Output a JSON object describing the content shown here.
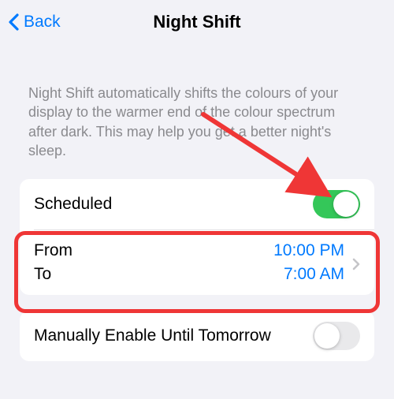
{
  "nav": {
    "back_label": "Back",
    "title": "Night Shift"
  },
  "description": "Night Shift automatically shifts the colours of your display to the warmer end of the colour spectrum after dark. This may help you get a better night's sleep.",
  "scheduled": {
    "label": "Scheduled",
    "enabled": true
  },
  "schedule_time": {
    "from_label": "From",
    "from_value": "10:00 PM",
    "to_label": "To",
    "to_value": "7:00 AM"
  },
  "manual": {
    "label": "Manually Enable Until Tomorrow",
    "enabled": false
  },
  "colors": {
    "link": "#007aff",
    "toggle_on": "#34c759",
    "toggle_off": "#e9e9eb",
    "annotation": "#ef3636"
  }
}
